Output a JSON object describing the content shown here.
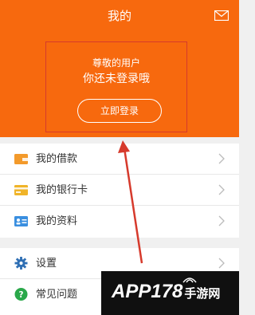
{
  "header": {
    "title": "我的",
    "mail_icon": "mail-icon",
    "bg_color": "#f7690e"
  },
  "profile": {
    "greeting": "尊敬的用户",
    "status": "你还未登录哦",
    "login_label": "立即登录"
  },
  "menu_group1": [
    {
      "label": "我的借款",
      "icon": "wallet-icon",
      "icon_color": "#f39a2b"
    },
    {
      "label": "我的银行卡",
      "icon": "bank-card-icon",
      "icon_color": "#f0b429"
    },
    {
      "label": "我的资料",
      "icon": "id-card-icon",
      "icon_color": "#3a8fe0"
    }
  ],
  "menu_group2": [
    {
      "label": "设置",
      "icon": "gear-icon",
      "icon_color": "#2f6fb4"
    },
    {
      "label": "常见问题",
      "icon": "question-icon",
      "icon_color": "#2aa84a"
    }
  ],
  "watermark": {
    "text": "APP178",
    "sub": "手游网"
  },
  "annotation_color": "#d63a2c"
}
